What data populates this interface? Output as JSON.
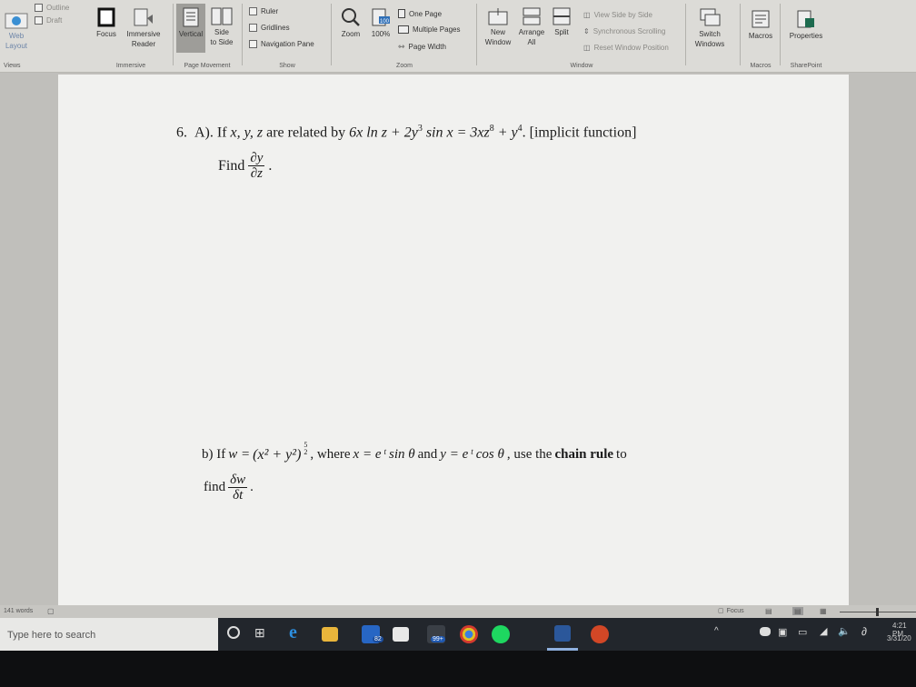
{
  "ribbon": {
    "views": {
      "outline": "Outline",
      "draft": "Draft",
      "web_layout": "Web\nLayout",
      "group": "Views"
    },
    "immersive": {
      "focus": "Focus",
      "immersive_reader": "Immersive\nReader",
      "group": "Immersive"
    },
    "page_movement": {
      "vertical": "Vertical",
      "side_to_side": "Side\nto Side",
      "group": "Page Movement"
    },
    "show": {
      "ruler": "Ruler",
      "gridlines": "Gridlines",
      "navigation_pane": "Navigation Pane",
      "group": "Show"
    },
    "zoom": {
      "zoom": "Zoom",
      "hundred": "100%",
      "hundred_icon": "100",
      "one_page": "One Page",
      "multiple_pages": "Multiple Pages",
      "page_width": "Page Width",
      "group": "Zoom"
    },
    "window": {
      "new_window": "New\nWindow",
      "arrange_all": "Arrange\nAll",
      "split": "Split",
      "view_side_by_side": "View Side by Side",
      "sync_scrolling": "Synchronous Scrolling",
      "reset_position": "Reset Window Position",
      "switch_windows": "Switch\nWindows",
      "group": "Window"
    },
    "macros": {
      "label": "Macros",
      "group": "Macros"
    },
    "sharepoint": {
      "properties": "Properties",
      "group": "SharePoint"
    }
  },
  "document": {
    "q6_number": "6.",
    "q6_part": "A).",
    "q6_text_a": "If",
    "q6_vars": "x, y, z",
    "q6_text_b": "are related by",
    "q6_eq_lhs": "6x ln z + 2y",
    "q6_exp_3": "3",
    "q6_eq_mid": " sin x = 3xz",
    "q6_exp_8": "8",
    "q6_eq_plus": " + y",
    "q6_exp_4": "4",
    "q6_tag": ". [implicit function]",
    "find_label": "Find",
    "frac_num_a": "∂y",
    "frac_den_a": "∂z",
    "q6_period": ".",
    "qb_label": "b) If",
    "qb_w": "w =",
    "qb_paren": "(x² + y²)",
    "qb_exp_num": "5",
    "qb_exp_den": "2",
    "qb_where": ", where",
    "qb_x_eq": "x = e",
    "qb_t1": "t",
    "qb_sin": " sin θ",
    "qb_and": "and",
    "qb_y_eq": "y = e",
    "qb_t2": "t",
    "qb_cos": " cos θ",
    "qb_tail_a": ", use the",
    "qb_bold": "chain rule",
    "qb_tail_b": "to",
    "find_lower": "find",
    "frac_num_b": "δw",
    "frac_den_b": "δt",
    "qb_period": "."
  },
  "status": {
    "words": "141 words",
    "focus": "Focus"
  },
  "taskbar": {
    "search_placeholder": "Type here to search",
    "mail_badge": "82",
    "store_badge": "99+",
    "time": "4:21 PM",
    "date": "3/31/20"
  }
}
